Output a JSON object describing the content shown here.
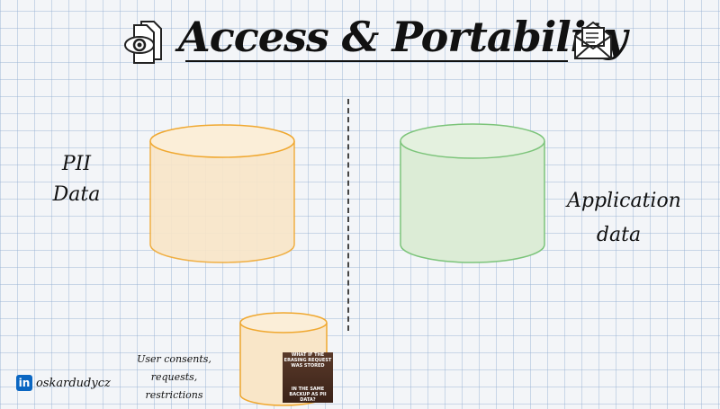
{
  "title": "Access & Portability",
  "left_label": {
    "line1": "PII",
    "line2": "Data"
  },
  "right_label": {
    "line1": "Application",
    "line2": "data"
  },
  "small_label": {
    "line1": "User consents, requests,",
    "line2": "restrictions"
  },
  "meme": {
    "top": "WHAT IF THE ERASING REQUEST WAS STORED",
    "bottom": "IN THE SAME BACKUP AS PII DATA?"
  },
  "footer": {
    "icon": "linkedin-icon",
    "handle": "oskardudycz"
  },
  "colors": {
    "pii_db": "#f0a830",
    "app_db": "#7cc47a"
  },
  "icons": [
    "eye-document-icon",
    "open-envelope-icon"
  ]
}
